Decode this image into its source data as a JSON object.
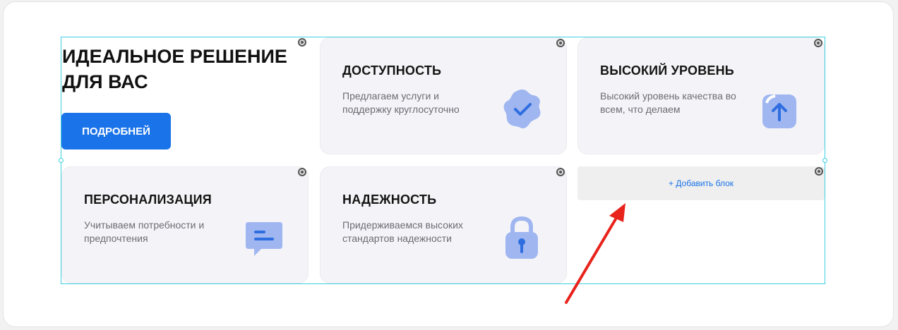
{
  "hero": {
    "title": "ИДЕАЛЬНОЕ РЕШЕНИЕ ДЛЯ ВАС",
    "button_label": "ПОДРОБНЕЙ"
  },
  "cards": [
    {
      "title": "ДОСТУПНОСТЬ",
      "description": "Предлагаем услуги и поддержку круглосуточно",
      "icon": "badge-check-icon"
    },
    {
      "title": "ВЫСОКИЙ УРОВЕНЬ",
      "description": "Высокий уровень качества во всем, что делаем",
      "icon": "arrow-up-icon"
    },
    {
      "title": "ПЕРСОНАЛИЗАЦИЯ",
      "description": "Учитываем потребности и предпочтения",
      "icon": "chat-bubble-icon"
    },
    {
      "title": "НАДЕЖНОСТЬ",
      "description": "Придерживаемся высоких стандартов надежности",
      "icon": "padlock-icon"
    }
  ],
  "add_block_label": "+ Добавить блок",
  "colors": {
    "accent": "#1a73e8",
    "selection": "#3ecfe0",
    "annotation_arrow": "#e8231c"
  }
}
